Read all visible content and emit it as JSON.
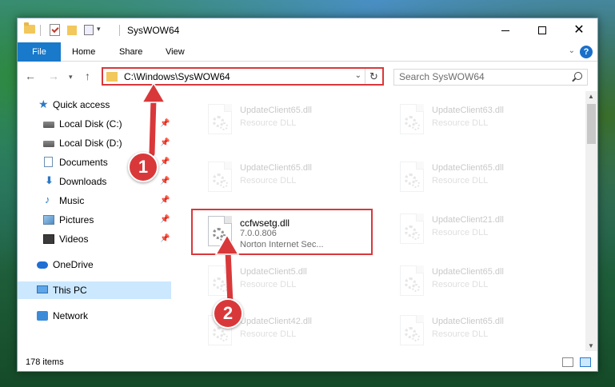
{
  "window": {
    "title": "SysWOW64"
  },
  "ribbon": {
    "tabs": [
      "File",
      "Home",
      "Share",
      "View"
    ],
    "help_label": "?"
  },
  "address": {
    "path": "C:\\Windows\\SysWOW64"
  },
  "search": {
    "placeholder": "Search SysWOW64"
  },
  "nav_pane": {
    "items": [
      {
        "label": "Quick access",
        "icon": "star-icon",
        "pinned": false
      },
      {
        "label": "Local Disk (C:)",
        "icon": "disk-icon",
        "pinned": true
      },
      {
        "label": "Local Disk (D:)",
        "icon": "disk-icon",
        "pinned": true
      },
      {
        "label": "Documents",
        "icon": "documents-icon",
        "pinned": true
      },
      {
        "label": "Downloads",
        "icon": "download-icon",
        "pinned": true
      },
      {
        "label": "Music",
        "icon": "music-icon",
        "pinned": true
      },
      {
        "label": "Pictures",
        "icon": "pictures-icon",
        "pinned": true
      },
      {
        "label": "Videos",
        "icon": "videos-icon",
        "pinned": true
      },
      {
        "label": "OneDrive",
        "icon": "cloud-icon",
        "pinned": false
      },
      {
        "label": "This PC",
        "icon": "computer-icon",
        "pinned": false,
        "selected": true
      },
      {
        "label": "Network",
        "icon": "network-icon",
        "pinned": false
      }
    ]
  },
  "files": {
    "left": [
      {
        "name": "UpdateClient65.dll",
        "type": "Resource DLL"
      },
      {
        "name": "UpdateClient65.dll",
        "type": "Resource DLL"
      },
      {
        "name": "ccfwsetg.dll",
        "version": "7.0.0.806",
        "company": "Norton Internet Sec..."
      },
      {
        "name": "UpdateClient5.dll",
        "type": "Resource DLL"
      },
      {
        "name": "UpdateClient42.dll",
        "type": "Resource DLL"
      }
    ],
    "right": [
      {
        "name": "UpdateClient63.dll",
        "type": "Resource DLL"
      },
      {
        "name": "UpdateClient65.dll",
        "type": "Resource DLL"
      },
      {
        "name": "UpdateClient21.dll",
        "type": "Resource DLL"
      },
      {
        "name": "UpdateClient65.dll",
        "type": "Resource DLL"
      },
      {
        "name": "UpdateClient65.dll",
        "type": "Resource DLL"
      }
    ]
  },
  "status": {
    "item_count": "178 items"
  },
  "annotations": {
    "callout_1": "1",
    "callout_2": "2",
    "color": "#d9383a"
  },
  "colors": {
    "file_tab": "#1979ca",
    "selected_nav": "#cce8ff",
    "highlight": "#d9383a"
  }
}
